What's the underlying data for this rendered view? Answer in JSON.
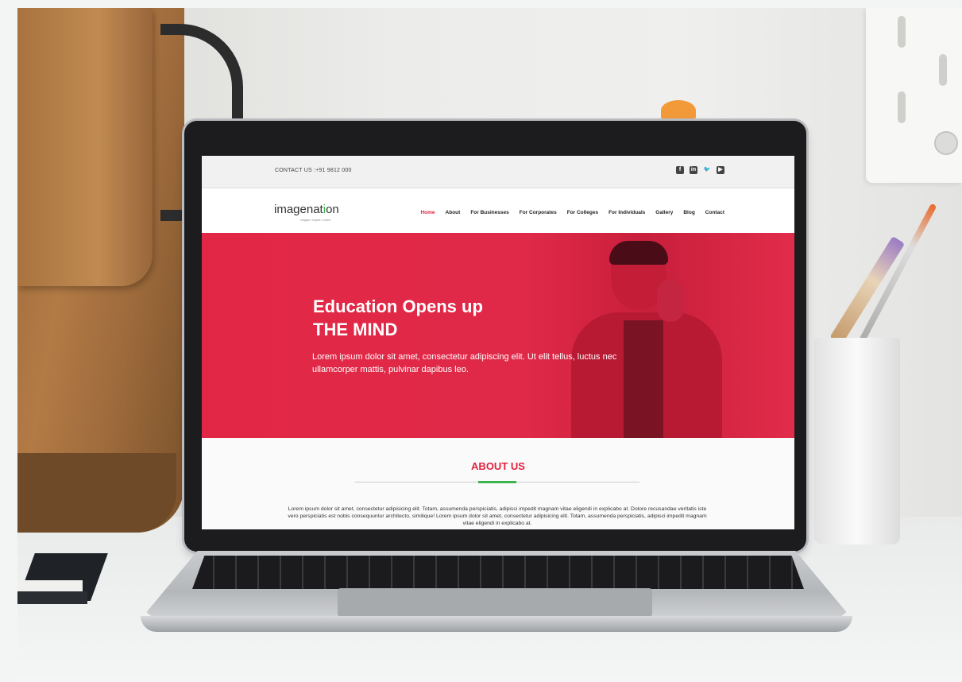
{
  "site": {
    "topbar": {
      "contact": "CONTACT US :+91 9812 000",
      "socials": [
        "facebook-icon",
        "linkedin-icon",
        "twitter-icon",
        "youtube-icon"
      ]
    },
    "logo": {
      "prefix": "imagenat",
      "mark": "i",
      "suffix": "on",
      "tagline": "imagine • inspire • invent"
    },
    "nav": [
      "Home",
      "About",
      "For Businesses",
      "For Corporates",
      "For Colleges",
      "For Individuals",
      "Gallery",
      "Blog",
      "Contact"
    ],
    "hero": {
      "title_line1": "Education Opens up",
      "title_line2": "THE MIND",
      "text": "Lorem ipsum dolor sit amet, consectetur adipiscing elit. Ut elit tellus, luctus nec ullamcorper mattis, pulvinar dapibus leo."
    },
    "about": {
      "title": "ABOUT US",
      "text": "Lorem ipsum dolor sit amet, consectetur adipisicing elit. Totam, assumenda perspiciatis, adipisci impedit magnam vitae eligendi in explicabo at. Dolore recusandae veritatis iste vero perspiciatis est nobis consequuntur architecto, similique! Lorem ipsum dolor sit amet, consectetur adipisicing elit. Totam, assumenda perspiciatis, adipisci impedit magnam vitae eligendi in explicabo at."
    }
  },
  "colors": {
    "brand": "#e2223e",
    "accent": "#3bb54a"
  }
}
